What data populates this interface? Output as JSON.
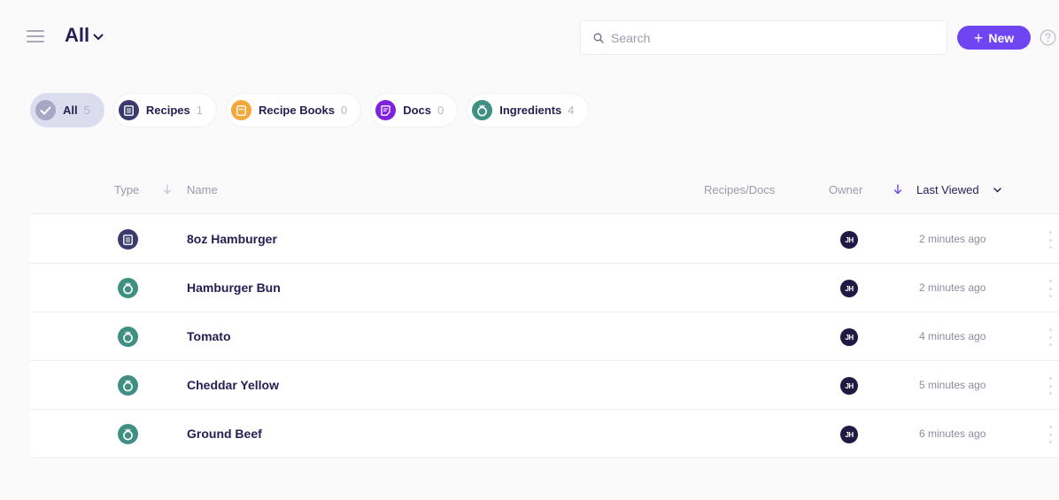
{
  "header": {
    "title": "All",
    "title_icon": "chevron-down-icon",
    "menu_icon": "hamburger-menu-icon",
    "search": {
      "placeholder": "Search",
      "value": "",
      "icon": "search-icon"
    },
    "new_button": {
      "label": "New",
      "icon": "plus-icon"
    },
    "help_icon": "question-circle-icon"
  },
  "colors": {
    "accent": "#6f45f2",
    "recipe": "#3b3a6d",
    "recipe_book": "#f2a83a",
    "doc": "#7f22e0",
    "ingredient": "#3f8f82",
    "all_pill": "#dcdcef"
  },
  "filters": [
    {
      "label": "All",
      "count": "5",
      "icon": "check-icon",
      "active": true
    },
    {
      "label": "Recipes",
      "count": "1",
      "icon": "recipe-icon",
      "active": false
    },
    {
      "label": "Recipe Books",
      "count": "0",
      "icon": "recipe-book-icon",
      "active": false
    },
    {
      "label": "Docs",
      "count": "0",
      "icon": "doc-icon",
      "active": false
    },
    {
      "label": "Ingredients",
      "count": "4",
      "icon": "ingredient-icon",
      "active": false
    }
  ],
  "table": {
    "columns": {
      "type": "Type",
      "name": "Name",
      "recipes_docs": "Recipes/Docs",
      "owner": "Owner",
      "last_viewed": "Last Viewed"
    },
    "rows": [
      {
        "type": "recipe",
        "name": "8oz Hamburger",
        "owner": "JH",
        "last_viewed": "2 minutes ago"
      },
      {
        "type": "ingredient",
        "name": "Hamburger Bun",
        "owner": "JH",
        "last_viewed": "2 minutes ago"
      },
      {
        "type": "ingredient",
        "name": "Tomato",
        "owner": "JH",
        "last_viewed": "4 minutes ago"
      },
      {
        "type": "ingredient",
        "name": "Cheddar Yellow",
        "owner": "JH",
        "last_viewed": "5 minutes ago"
      },
      {
        "type": "ingredient",
        "name": "Ground Beef",
        "owner": "JH",
        "last_viewed": "6 minutes ago"
      }
    ]
  }
}
